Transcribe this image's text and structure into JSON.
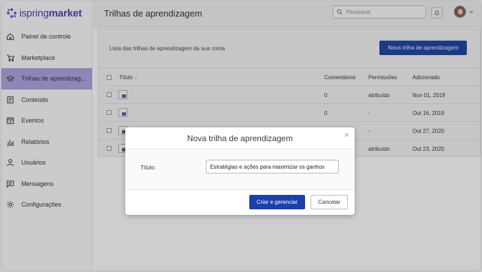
{
  "app": {
    "logo_light": "ispring",
    "logo_bold": "market",
    "brand_color": "#4a3aa8"
  },
  "sidebar": {
    "items": [
      {
        "label": "Painel de controle",
        "icon": "home-icon"
      },
      {
        "label": "Marketplace",
        "icon": "cart-icon"
      },
      {
        "label": "Trilhas de aprendizag...",
        "icon": "graduation-cap-icon",
        "active": true
      },
      {
        "label": "Conteúdo",
        "icon": "content-icon"
      },
      {
        "label": "Eventos",
        "icon": "calendar-icon"
      },
      {
        "label": "Relatórios",
        "icon": "bar-chart-icon"
      },
      {
        "label": "Usuários",
        "icon": "user-icon"
      },
      {
        "label": "Mensagens",
        "icon": "message-icon"
      },
      {
        "label": "Configurações",
        "icon": "gear-icon"
      }
    ]
  },
  "header": {
    "title": "Trilhas de aprendizagem",
    "search_placeholder": "Pesquisar"
  },
  "main": {
    "description": "Lista das trilhas de aprendizagem da sua conta",
    "new_button": "Nova trilha de aprendizagem",
    "table": {
      "columns": [
        "Título",
        "Comentários",
        "Permissões",
        "Adicionado"
      ],
      "sort_indicator": "↓",
      "rows": [
        {
          "comments": "0",
          "permissions": "atribuído",
          "added": "Nov 01, 2019"
        },
        {
          "comments": "0",
          "permissions": "-",
          "added": "Out 16, 2019"
        },
        {
          "comments": "",
          "permissions": "-",
          "added": "Out 27, 2020"
        },
        {
          "comments": "",
          "permissions": "atribuído",
          "added": "Out 23, 2020"
        }
      ]
    }
  },
  "modal": {
    "title": "Nova trilha de aprendizagem",
    "close": "×",
    "field_label": "Título:",
    "field_value": "Estratégias e ações para maximizar os ganhos",
    "primary_button": "Criar e gerenciar",
    "secondary_button": "Cancelar"
  }
}
